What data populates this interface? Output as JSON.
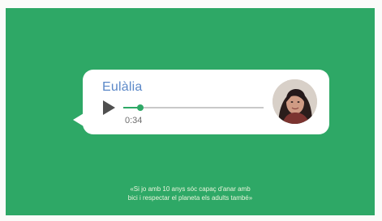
{
  "message": {
    "sender": "Eulàlia",
    "duration": "0:34",
    "playback_progress": 0.12
  },
  "controls": {
    "play_icon": "play-icon"
  },
  "avatar": {
    "icon": "user-avatar"
  },
  "caption": {
    "line1": "«Si jo amb 10 anys sóc capaç d'anar amb",
    "line2": "bici i respectar el planeta els adults també»"
  },
  "colors": {
    "background": "#2ea866",
    "bubble": "#ffffff",
    "sender": "#5b88c8",
    "progress": "#2ea866",
    "caption": "#eaf5dc"
  }
}
